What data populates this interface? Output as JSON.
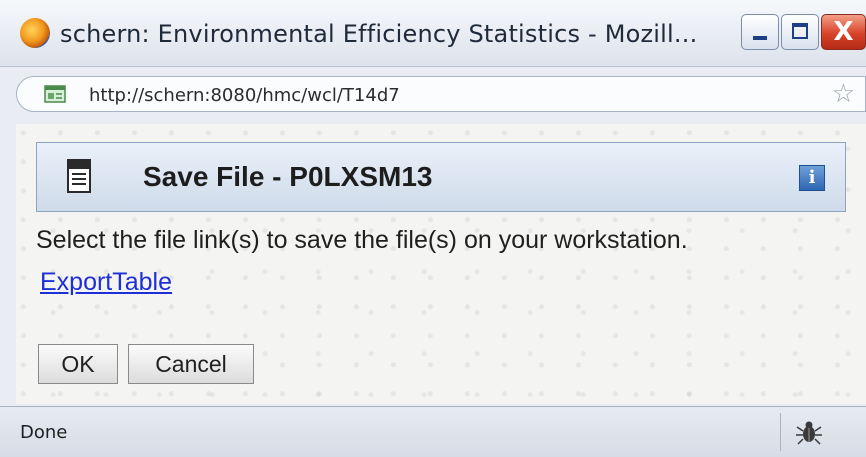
{
  "window": {
    "title": "schern: Environmental Efficiency Statistics - Mozill...",
    "close_glyph": "X"
  },
  "urlbar": {
    "url": "http://schern:8080/hmc/wcl/T14d7",
    "star_glyph": "☆"
  },
  "panel": {
    "title": "Save File - P0LXSM13",
    "info_glyph": "i"
  },
  "content": {
    "instructions": "Select the file link(s) to save the file(s) on your workstation.",
    "file_link": "ExportTable"
  },
  "buttons": {
    "ok": "OK",
    "cancel": "Cancel"
  },
  "statusbar": {
    "status": "Done"
  },
  "icons": [
    "firefox-icon",
    "site-icon",
    "bookmark-star-icon",
    "document-icon",
    "info-icon",
    "bug-icon"
  ],
  "colors": {
    "link": "#1e2fd8",
    "close_button": "#d8432a",
    "panel_header": "#cfdbea"
  }
}
